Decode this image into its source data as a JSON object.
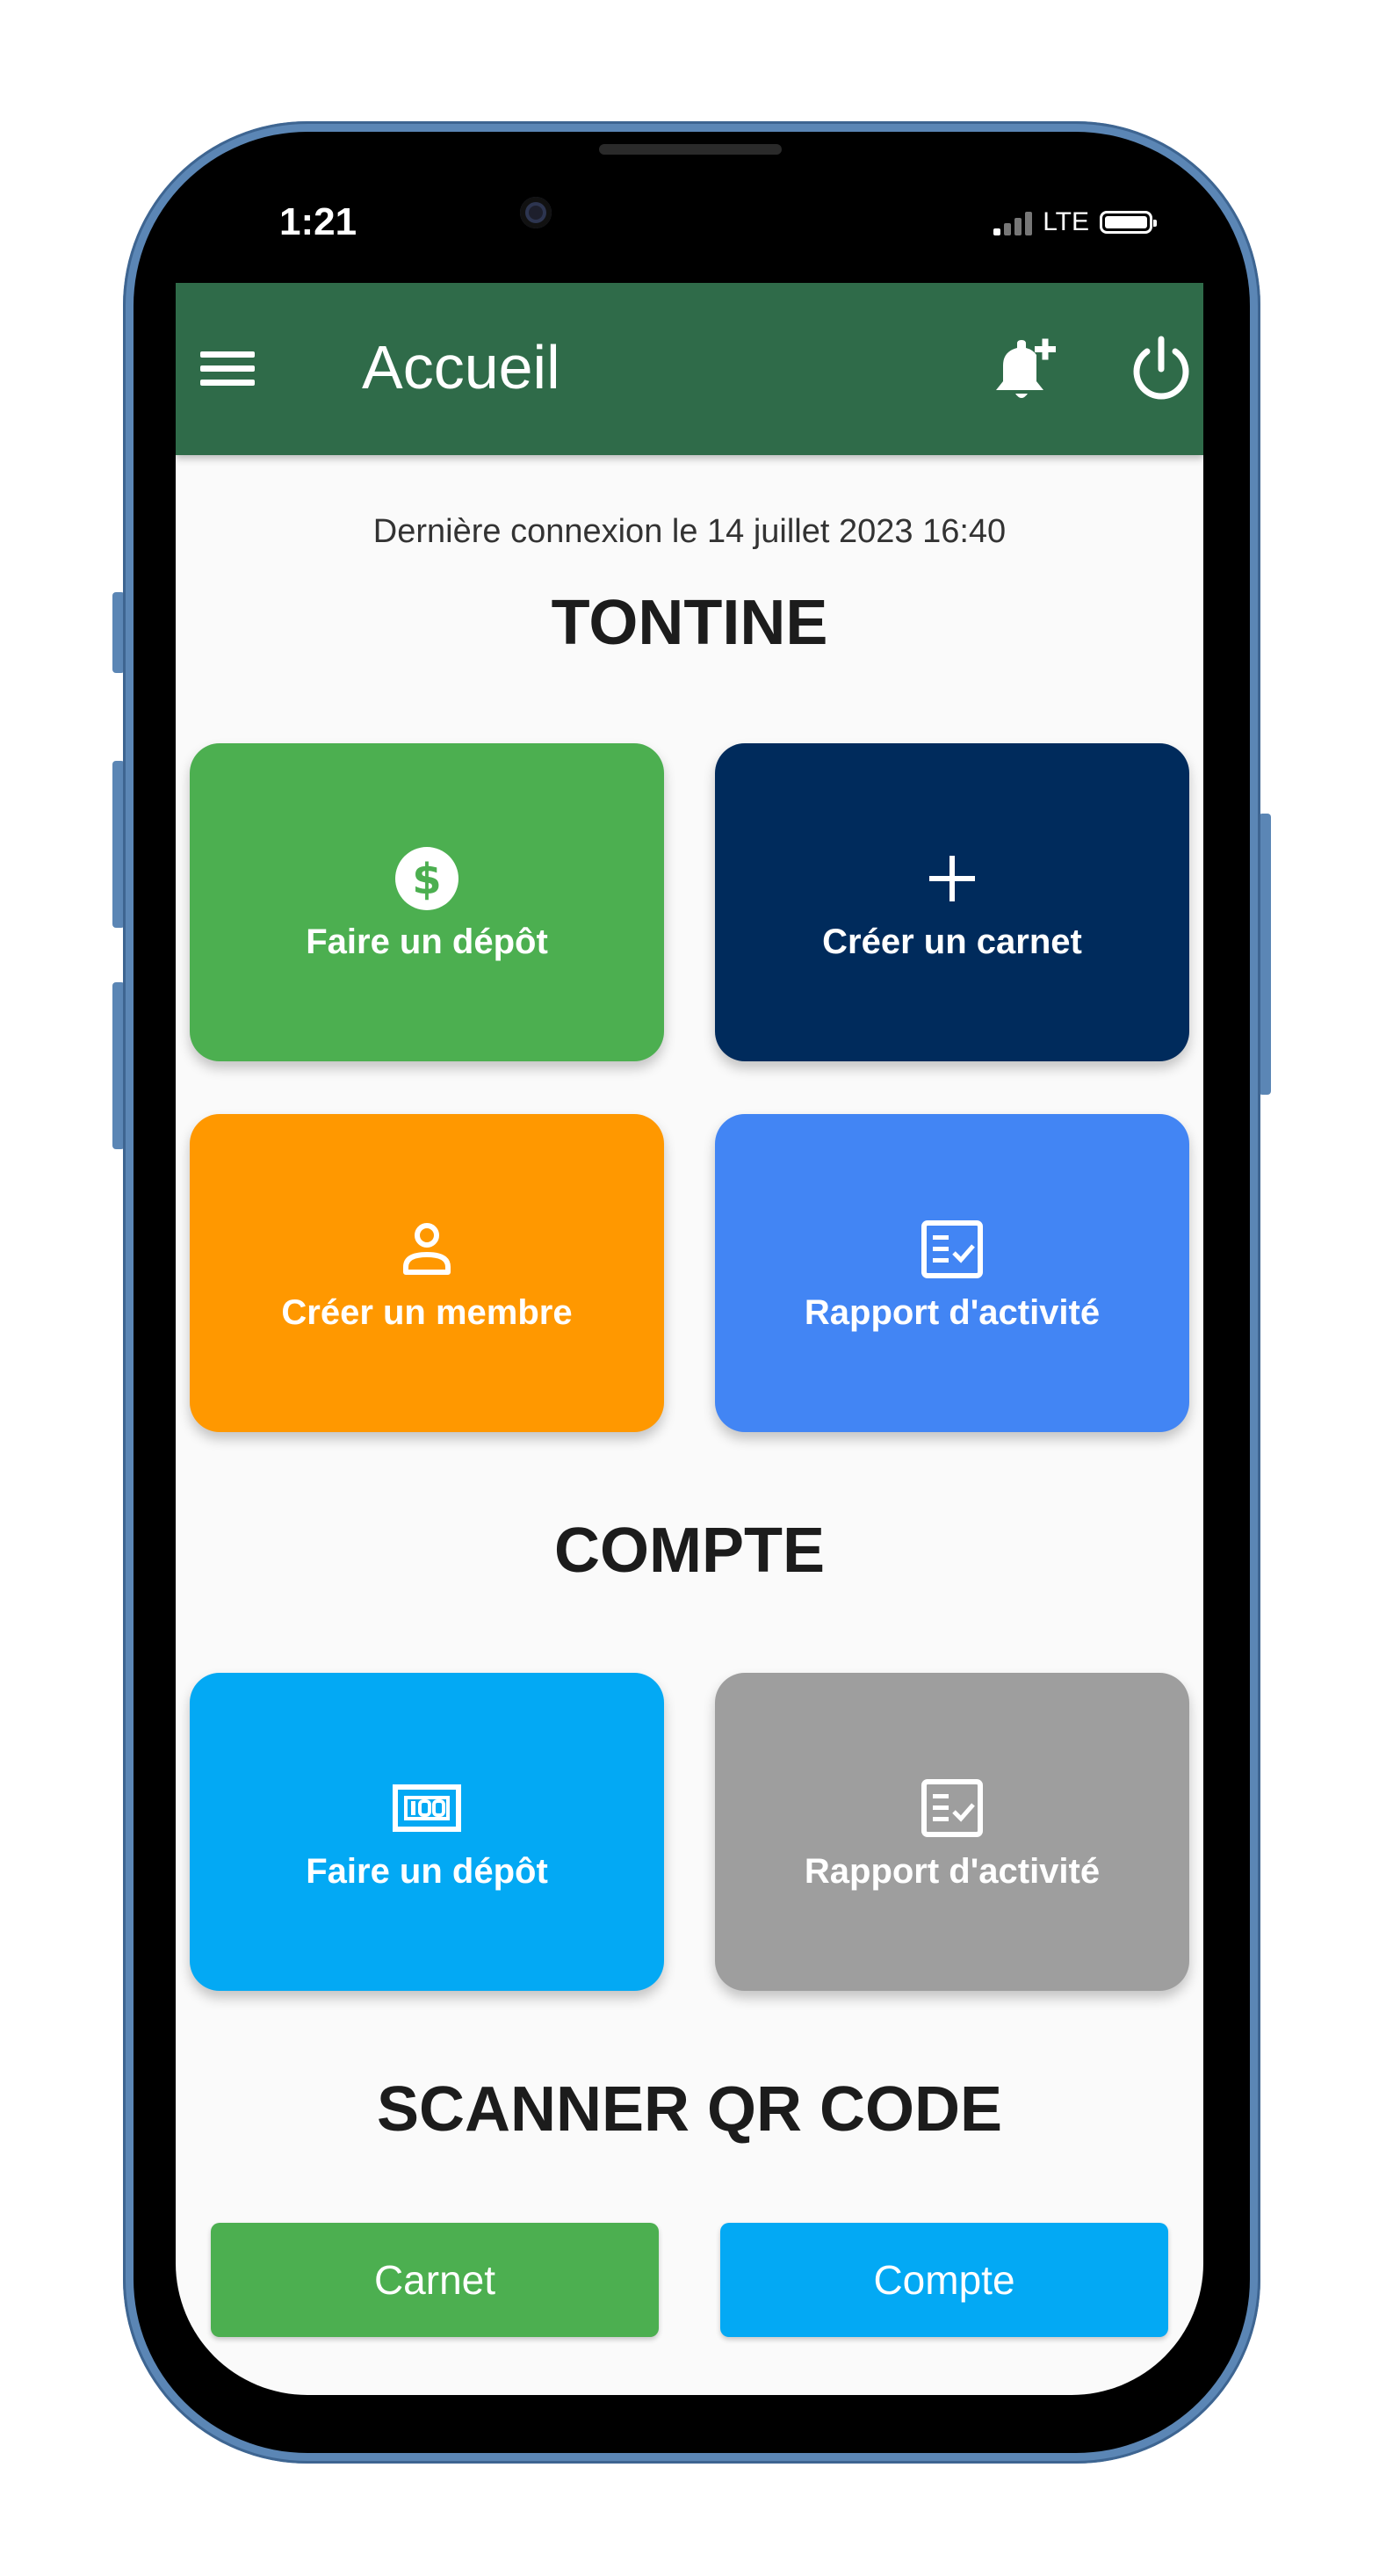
{
  "status_bar": {
    "time": "1:21",
    "network": "LTE"
  },
  "app_bar": {
    "title": "Accueil"
  },
  "last_login": "Dernière connexion le 14 juillet 2023 16:40",
  "sections": {
    "tontine": {
      "title": "TONTINE",
      "tiles": [
        {
          "label": "Faire un dépôt",
          "icon": "dollar-circle-icon",
          "color": "#4caf50"
        },
        {
          "label": "Créer un carnet",
          "icon": "plus-icon",
          "color": "#002b5c"
        },
        {
          "label": "Créer un membre",
          "icon": "person-icon",
          "color": "#ff9800"
        },
        {
          "label": "Rapport d'activité",
          "icon": "checklist-icon",
          "color": "#4285f4"
        }
      ]
    },
    "compte": {
      "title": "COMPTE",
      "tiles": [
        {
          "label": "Faire un dépôt",
          "icon": "money-icon",
          "color": "#03a9f4"
        },
        {
          "label": "Rapport d'activité",
          "icon": "checklist-icon",
          "color": "#9e9e9e"
        }
      ]
    },
    "scanner": {
      "title": "SCANNER QR CODE",
      "buttons": [
        {
          "label": "Carnet",
          "color": "#4caf50"
        },
        {
          "label": "Compte",
          "color": "#03a9f4"
        }
      ]
    }
  }
}
